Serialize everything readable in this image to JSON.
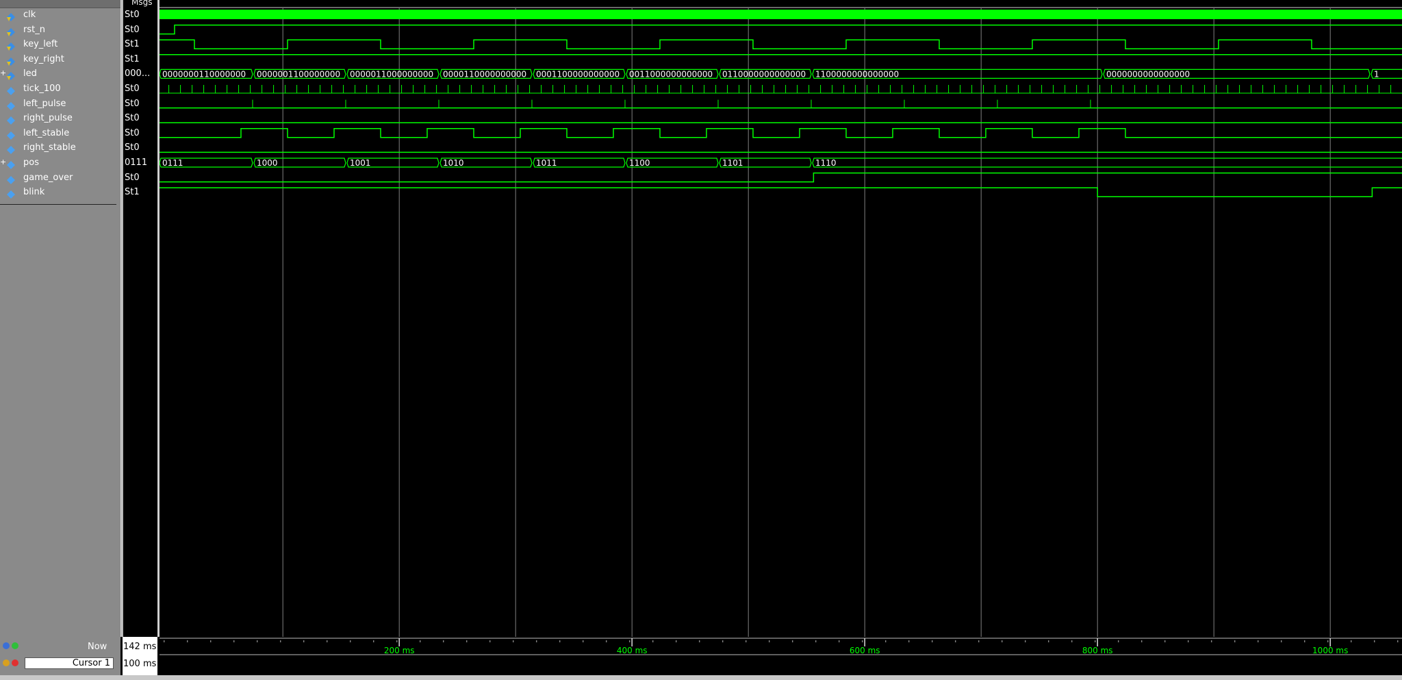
{
  "header": {
    "msgs_label": "Msgs"
  },
  "signals": [
    {
      "name": "clk",
      "value": "St0",
      "icon": "signal-arrow-icon",
      "expandable": false
    },
    {
      "name": "rst_n",
      "value": "St0",
      "icon": "signal-arrow-icon",
      "expandable": false
    },
    {
      "name": "key_left",
      "value": "St1",
      "icon": "signal-arrow-icon",
      "expandable": false
    },
    {
      "name": "key_right",
      "value": "St1",
      "icon": "signal-arrow-icon",
      "expandable": false
    },
    {
      "name": "led",
      "value": "000...",
      "icon": "bus-arrow-icon",
      "expandable": true
    },
    {
      "name": "tick_100",
      "value": "St0",
      "icon": "signal-diamond-icon",
      "expandable": false
    },
    {
      "name": "left_pulse",
      "value": "St0",
      "icon": "signal-diamond-icon",
      "expandable": false
    },
    {
      "name": "right_pulse",
      "value": "St0",
      "icon": "signal-diamond-icon",
      "expandable": false
    },
    {
      "name": "left_stable",
      "value": "St0",
      "icon": "signal-diamond-icon",
      "expandable": false
    },
    {
      "name": "right_stable",
      "value": "St0",
      "icon": "signal-diamond-icon",
      "expandable": false
    },
    {
      "name": "pos",
      "value": "0111",
      "icon": "bus-diamond-icon",
      "expandable": true
    },
    {
      "name": "game_over",
      "value": "St0",
      "icon": "signal-diamond-icon",
      "expandable": false
    },
    {
      "name": "blink",
      "value": "St1",
      "icon": "signal-diamond-icon",
      "expandable": false
    }
  ],
  "bus_values": {
    "led": [
      "0000000110000000",
      "0000001100000000",
      "0000011000000000",
      "0000110000000000",
      "0001100000000000",
      "0011000000000000",
      "0110000000000000",
      "1100000000000000",
      "0000000000000000",
      "1"
    ],
    "pos": [
      "0111",
      "1000",
      "1001",
      "1010",
      "1011",
      "1100",
      "1101",
      "1110"
    ]
  },
  "timeline": {
    "tick_labels": [
      "200 ms",
      "400 ms",
      "600 ms",
      "800 ms",
      "1000 ms"
    ],
    "tick_values_ms": [
      200,
      400,
      600,
      800,
      1000
    ],
    "grid_values_ms": [
      92,
      192,
      292,
      392,
      492,
      592,
      692,
      792,
      892,
      992
    ]
  },
  "bottom": {
    "now_label": "Now",
    "now_value": "142 ms",
    "cursor_label": "Cursor 1",
    "cursor_value": "100 ms"
  },
  "colors": {
    "wave": "#00ff00",
    "grid": "#808080",
    "text": "#ffffff",
    "names_bg": "#8a8a8a"
  }
}
